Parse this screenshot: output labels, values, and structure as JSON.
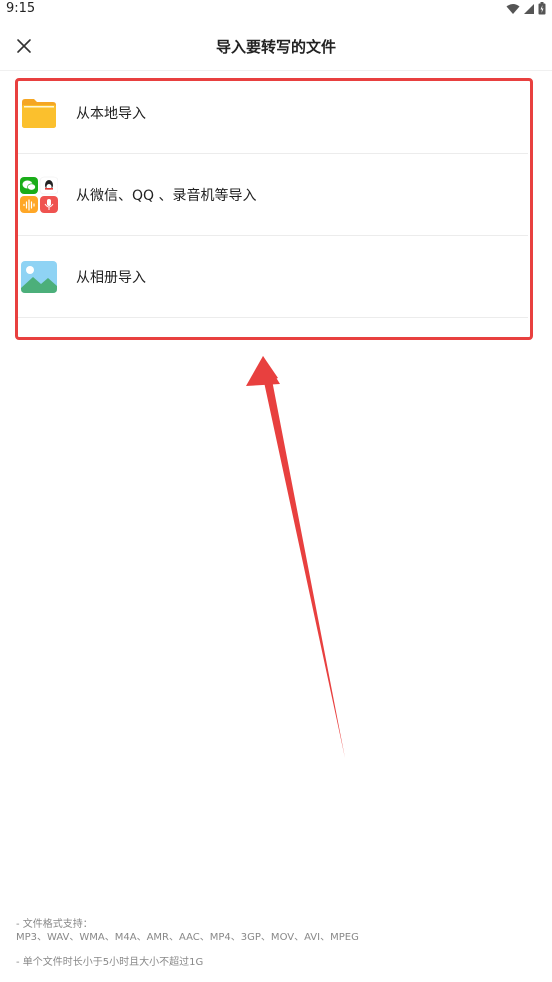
{
  "status_bar": {
    "time": "9:15"
  },
  "header": {
    "title": "导入要转写的文件"
  },
  "import_options": [
    {
      "label": "从本地导入",
      "icon": "folder-icon"
    },
    {
      "label": "从微信、QQ 、录音机等导入",
      "icon": "apps-grid-icon"
    },
    {
      "label": "从相册导入",
      "icon": "photo-icon"
    }
  ],
  "footer": {
    "formats_title": "- 文件格式支持：",
    "formats_list": "MP3、WAV、WMA、M4A、AMR、AAC、MP4、3GP、MOV、AVI、MPEG",
    "limit_note": "- 单个文件时长小于5小时且大小不超过1G"
  },
  "colors": {
    "annotation_red": "#e8403f",
    "folder_yellow": "#fbc02d",
    "wechat_green": "#1aad19"
  }
}
